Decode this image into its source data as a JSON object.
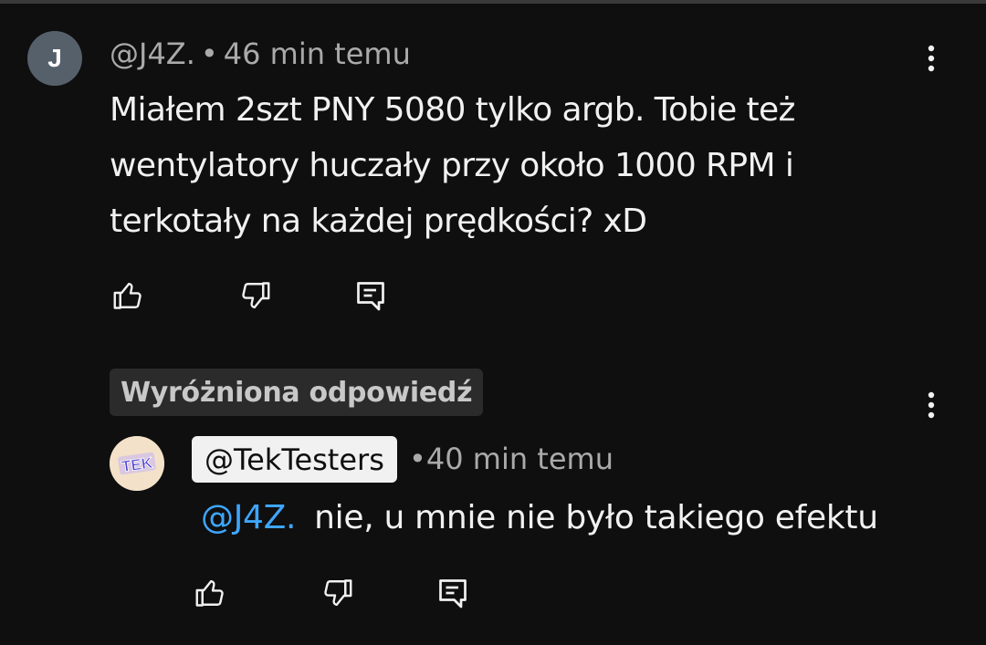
{
  "comment": {
    "avatar_letter": "J",
    "author": "@J4Z.",
    "separator": "•",
    "time": "46 min temu",
    "text": "Miałem 2szt PNY 5080 tylko argb. Tobie też wentylatory huczały przy około 1000 RPM i terkotały na każdej prędkości? xD",
    "icons": {
      "like": "thumbs-up-icon",
      "dislike": "thumbs-down-icon",
      "reply": "reply-icon",
      "menu": "more-vert-icon"
    }
  },
  "reply": {
    "pinned_label": "Wyróżniona odpowiedź",
    "avatar_logo_text": "TEK",
    "author": "@TekTesters",
    "separator": "•",
    "time": "40 min temu",
    "mention": "@J4Z.",
    "text": "nie, u mnie nie było takiego efektu",
    "icons": {
      "like": "thumbs-up-icon",
      "dislike": "thumbs-down-icon",
      "reply": "reply-icon",
      "menu": "more-vert-icon"
    }
  },
  "colors": {
    "background": "#0f0f0f",
    "text_primary": "#f1f1f1",
    "text_secondary": "#aaaaaa",
    "mention": "#3ea6ff",
    "avatar_j": "#56606b",
    "pinned_badge_bg": "#2b2b2b",
    "author_chip_bg": "#f1f1f1"
  }
}
